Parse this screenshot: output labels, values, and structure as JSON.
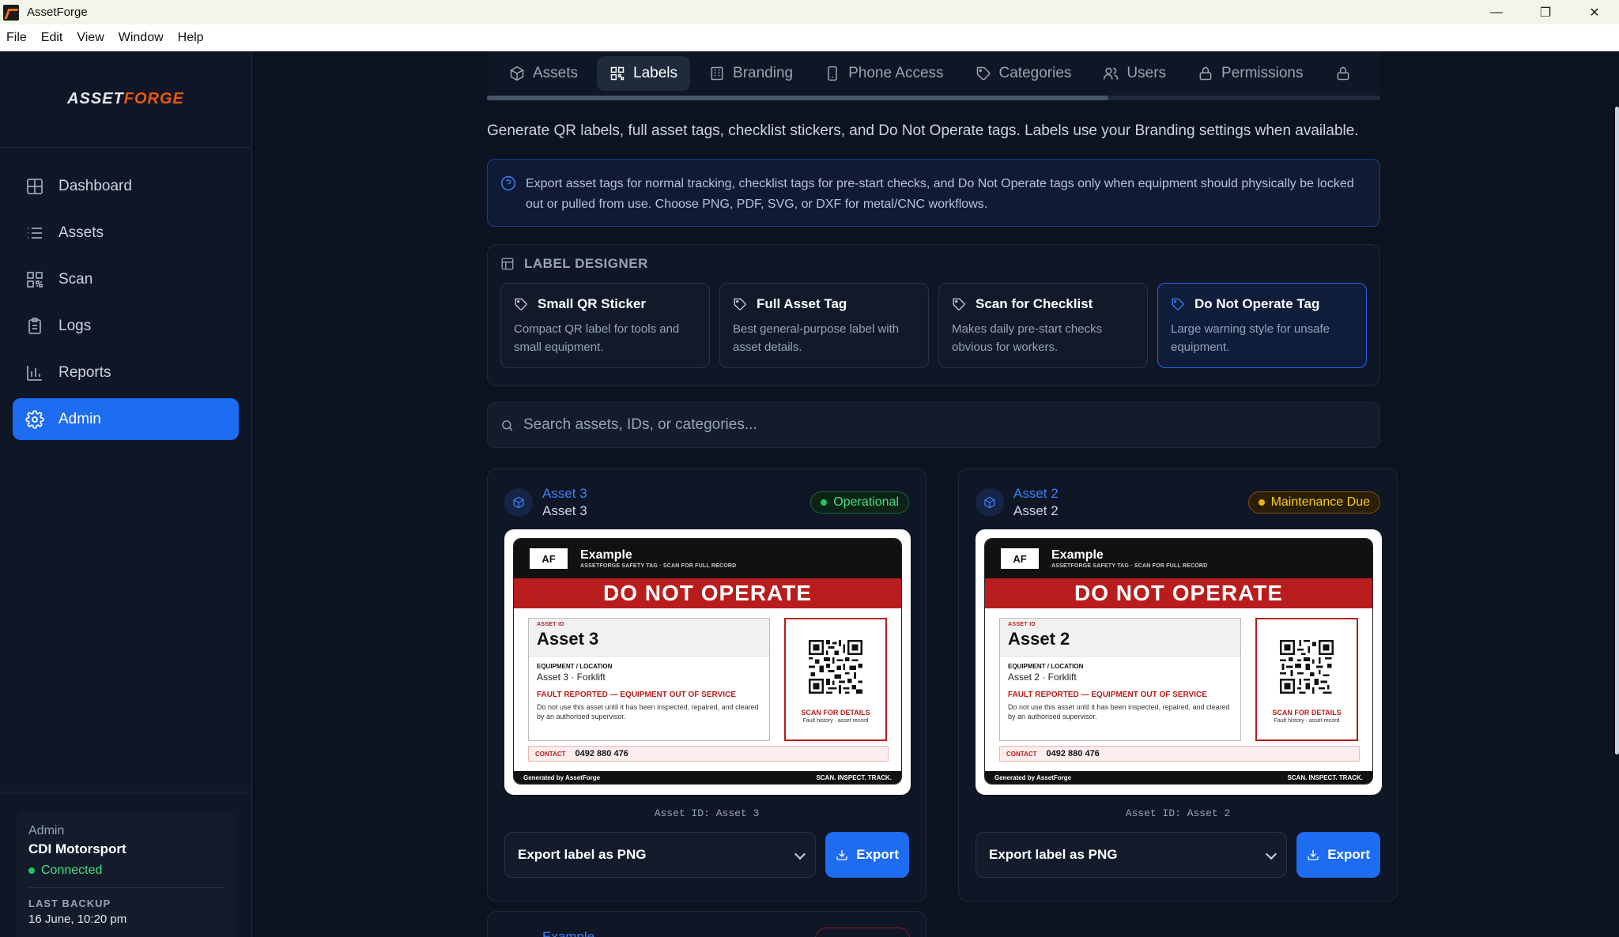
{
  "window": {
    "title": "AssetForge"
  },
  "menu": [
    "File",
    "Edit",
    "View",
    "Window",
    "Help"
  ],
  "brand": {
    "part1": "ASSET",
    "part2": "FORGE"
  },
  "nav": [
    {
      "label": "Dashboard",
      "icon": "dashboard-icon"
    },
    {
      "label": "Assets",
      "icon": "list-icon"
    },
    {
      "label": "Scan",
      "icon": "qr-icon"
    },
    {
      "label": "Logs",
      "icon": "clipboard-icon"
    },
    {
      "label": "Reports",
      "icon": "bar-chart-icon"
    },
    {
      "label": "Admin",
      "icon": "gear-icon",
      "active": true
    }
  ],
  "account": {
    "role": "Admin",
    "org": "CDI Motorsport",
    "status": "Connected",
    "backup_label": "LAST BACKUP",
    "backup_value": "16 June, 10:20 pm"
  },
  "tabs": [
    {
      "label": "Assets",
      "icon": "box-icon"
    },
    {
      "label": "Labels",
      "icon": "qr-icon",
      "active": true
    },
    {
      "label": "Branding",
      "icon": "building-icon"
    },
    {
      "label": "Phone Access",
      "icon": "phone-icon"
    },
    {
      "label": "Categories",
      "icon": "tag-icon"
    },
    {
      "label": "Users",
      "icon": "users-icon"
    },
    {
      "label": "Permissions",
      "icon": "lock-icon"
    }
  ],
  "intro": "Generate QR labels, full asset tags, checklist stickers, and Do Not Operate tags. Labels use your Branding settings when available.",
  "info": "Export asset tags for normal tracking, checklist tags for pre-start checks, and Do Not Operate tags only when equipment should physically be locked out or pulled from use. Choose PNG, PDF, SVG, or DXF for metal/CNC workflows.",
  "designer": {
    "title": "LABEL DESIGNER",
    "styles": [
      {
        "name": "Small QR Sticker",
        "desc": "Compact QR label for tools and small equipment."
      },
      {
        "name": "Full Asset Tag",
        "desc": "Best general-purpose label with asset details."
      },
      {
        "name": "Scan for Checklist",
        "desc": "Makes daily pre-start checks obvious for workers."
      },
      {
        "name": "Do Not Operate Tag",
        "desc": "Large warning style for unsafe equipment.",
        "selected": true
      }
    ]
  },
  "search": {
    "placeholder": "Search assets, IDs, or categories..."
  },
  "tag_common": {
    "af": "AF",
    "company": "Example",
    "company_sub": "ASSETFORGE SAFETY TAG · SCAN FOR FULL RECORD",
    "banner": "DO NOT OPERATE",
    "asset_id_label": "ASSET ID",
    "equip_label": "EQUIPMENT / LOCATION",
    "fault": "FAULT REPORTED — EQUIPMENT OUT OF SERVICE",
    "fault_desc": "Do not use this asset until it has been inspected, repaired, and cleared by an authorised supervisor.",
    "scan": "SCAN FOR DETAILS",
    "scan_sub": "Fault history · asset record",
    "contact_label": "CONTACT",
    "contact": "0492 880 476",
    "footer_left": "Generated by AssetForge",
    "footer_right": "SCAN. INSPECT. TRACK."
  },
  "assets": [
    {
      "link": "Asset 3",
      "name": "Asset 3",
      "status": "Operational",
      "tag_asset": "Asset 3",
      "equip": "Asset 3 · Forklift",
      "id_line": "Asset ID: Asset 3",
      "export_format": "Export label as PNG",
      "export_btn": "Export"
    },
    {
      "link": "Asset 2",
      "name": "Asset 2",
      "status": "Maintenance Due",
      "tag_asset": "Asset 2",
      "equip": "Asset 2 · Forklift",
      "id_line": "Asset ID: Asset 2",
      "export_format": "Export label as PNG",
      "export_btn": "Export"
    }
  ],
  "partial_card": {
    "link": "Example"
  },
  "colors": {
    "accent": "#1d6cf2",
    "danger": "#b91c1c",
    "ok": "#22c55e",
    "warn": "#eab308"
  }
}
